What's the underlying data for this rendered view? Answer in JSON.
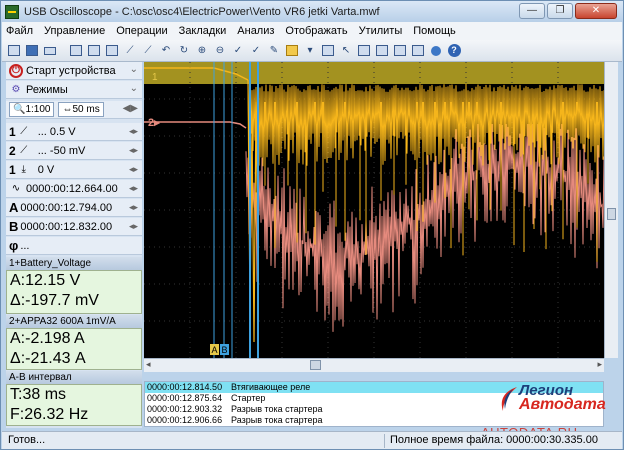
{
  "window": {
    "title": "USB Oscilloscope - C:\\osc\\osc4\\ElectricPower\\Vento VR6 jetki Varta.mwf",
    "minimize_label": "—",
    "restore_label": "❐",
    "close_label": "✕"
  },
  "menu": {
    "items": [
      "Файл",
      "Управление",
      "Операции",
      "Закладки",
      "Анализ",
      "Отображать",
      "Утилиты",
      "Помощь"
    ]
  },
  "left_panel": {
    "start_label": "Старт устройства",
    "modes_label": "Режимы",
    "ratio": "1:100",
    "timebase": "50 ms",
    "ch1_num": "1",
    "ch1_value": "... 0.5 V",
    "ch2_num": "2",
    "ch2_value": "... -50 mV",
    "trigger_num": "1",
    "trigger_value": "0 V",
    "offset_time": "0000:00:12.664.00",
    "cursor_a_label": "A",
    "cursor_a_time": "0000:00:12.794.00",
    "cursor_b_label": "B",
    "cursor_b_time": "0000:00:12.832.00",
    "phi_label": "φ",
    "phi_value": "..."
  },
  "measurements": {
    "ch1_header": "1+Battery_Voltage",
    "ch1_a": "A:12.15 V",
    "ch1_delta": "Δ:-197.7 mV",
    "ch2_header": "2+APPA32 600A 1mV/A",
    "ch2_a": "A:-2.198 A",
    "ch2_delta": "Δ:-21.43 A",
    "ab_header": "A-B интервал",
    "ab_t": "T:38 ms",
    "ab_f": "F:26.32 Hz"
  },
  "scope": {
    "ch1_marker": "1",
    "ch2_marker": "2",
    "trace1_color": "#f5b51b",
    "trace2_color": "#e58a7d",
    "cursor_a_tag": "A",
    "cursor_b_tag": "B",
    "cursor_color": "#3ea2e0"
  },
  "events": [
    {
      "time": "0000:00:12.814.50",
      "text": "Втягивающее реле"
    },
    {
      "time": "0000:00:12.875.64",
      "text": "Стартер"
    },
    {
      "time": "0000:00:12.903.32",
      "text": "Разрыв тока стартера"
    },
    {
      "time": "0000:00:12.906.66",
      "text": "Разрыв тока стартера"
    }
  ],
  "watermark": {
    "line1": "Легион",
    "line2": "Автодата",
    "url": "AUTODATA.RU"
  },
  "status": {
    "left": "Готов...",
    "right": "Полное время файла: 0000:00:30.335.00"
  }
}
